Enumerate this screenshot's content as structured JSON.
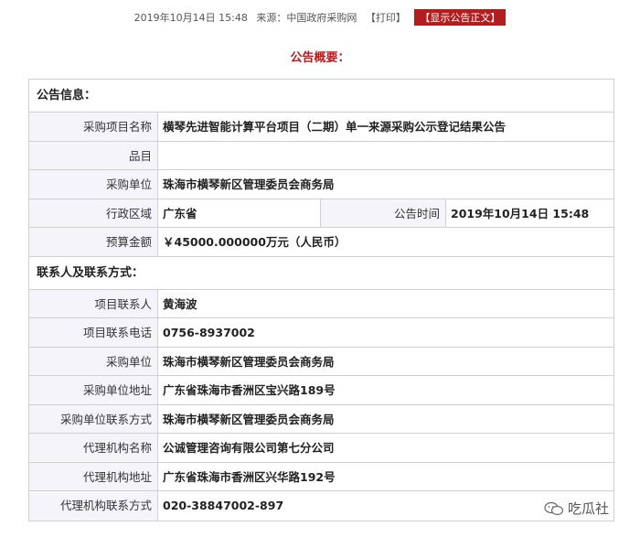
{
  "header": {
    "datetime": "2019年10月14日 15:48",
    "source": "来源：中国政府采购网",
    "print_label": "【打印】",
    "show_notice_label": "【显示公告正文】"
  },
  "summary_title": "公告概要：",
  "announcement": {
    "section_title": "公告信息：",
    "project_name_label": "采购项目名称",
    "project_name": "横琴先进智能计算平台项目（二期）单一来源采购公示登记结果公告",
    "item_label": "品目",
    "item": "",
    "buyer_label": "采购单位",
    "buyer": "珠海市横琴新区管理委员会商务局",
    "region_label": "行政区域",
    "region": "广东省",
    "publish_time_label": "公告时间",
    "publish_time": "2019年10月14日 15:48",
    "budget_label": "预算金额",
    "budget": "￥45000.000000万元（人民币）"
  },
  "contacts": {
    "section_title": "联系人及联系方式：",
    "rows": [
      {
        "label": "项目联系人",
        "value": "黄海波"
      },
      {
        "label": "项目联系电话",
        "value": "0756-8937002"
      },
      {
        "label": "采购单位",
        "value": "珠海市横琴新区管理委员会商务局"
      },
      {
        "label": "采购单位地址",
        "value": "广东省珠海市香洲区宝兴路189号"
      },
      {
        "label": "采购单位联系方式",
        "value": "珠海市横琴新区管理委员会商务局"
      },
      {
        "label": "代理机构名称",
        "value": "公诚管理咨询有限公司第七分公司"
      },
      {
        "label": "代理机构地址",
        "value": "广东省珠海市香洲区兴华路192号"
      },
      {
        "label": "代理机构联系方式",
        "value": "020-38847002-897"
      }
    ]
  },
  "watermark": {
    "icon": "wechat-icon",
    "text": "吃瓜社"
  }
}
